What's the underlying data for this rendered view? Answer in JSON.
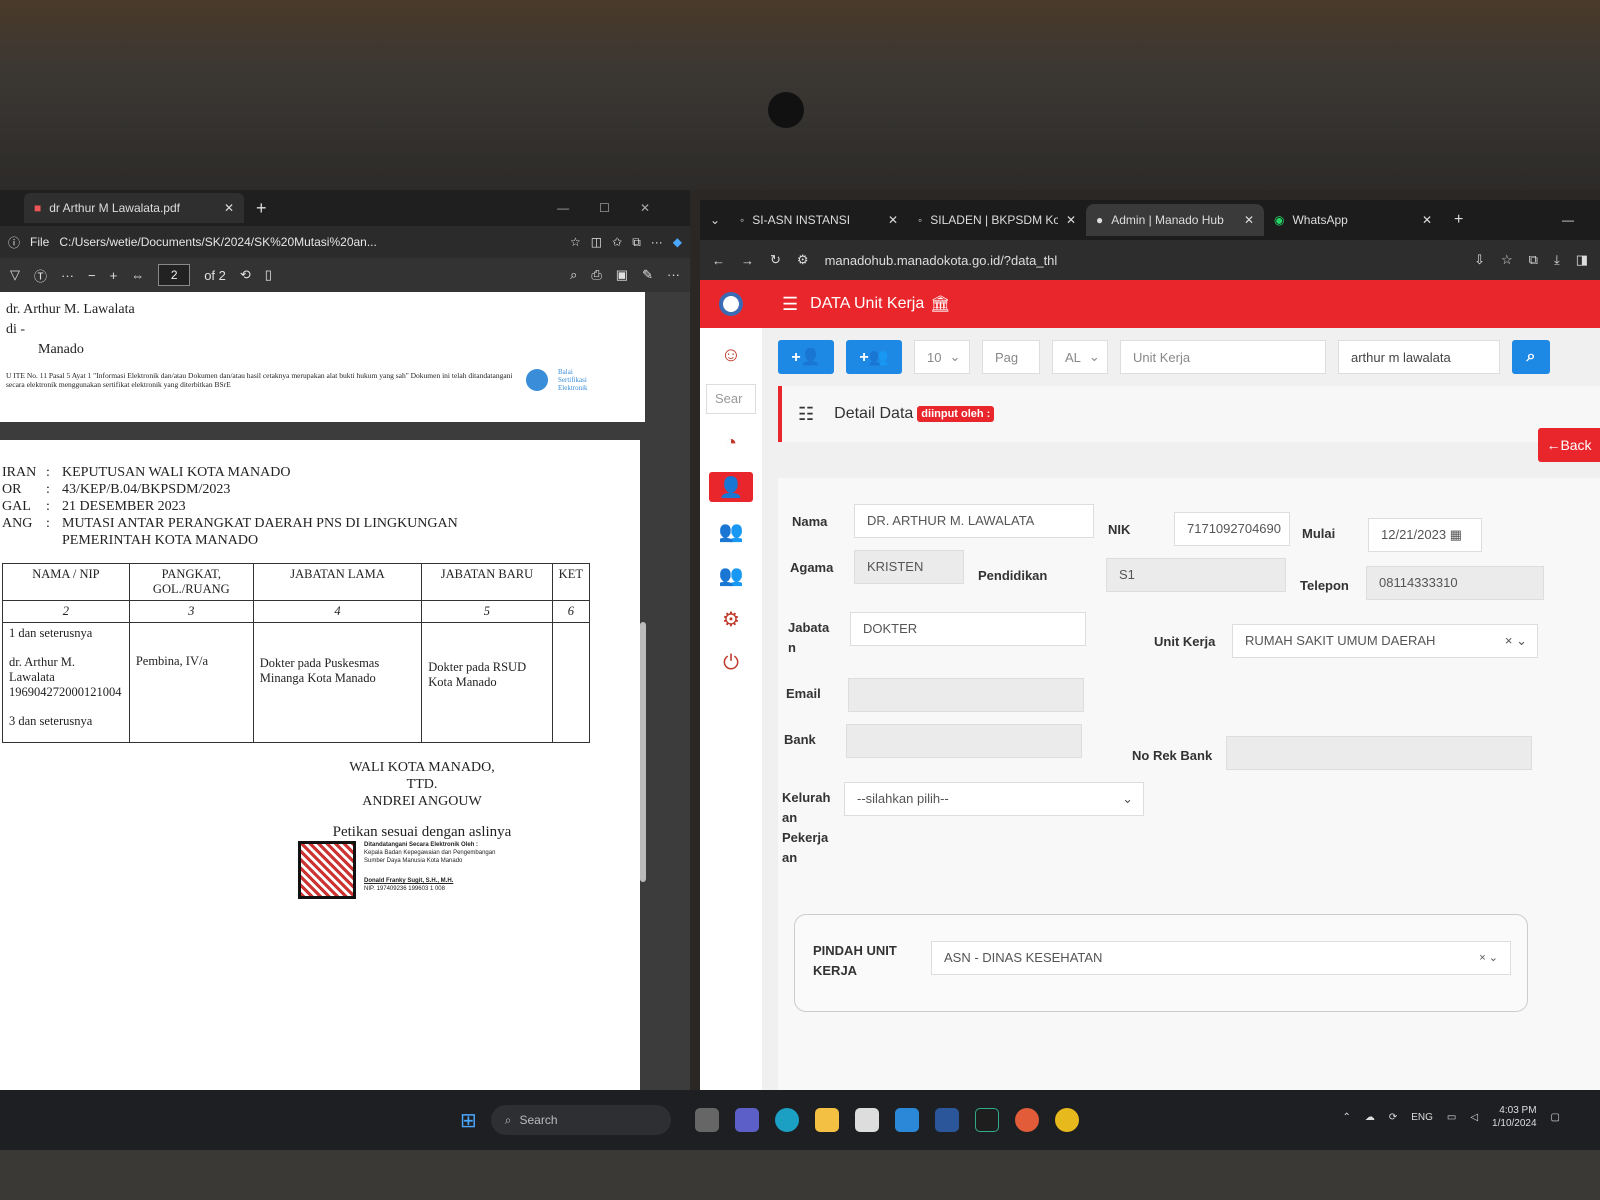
{
  "pdf": {
    "tab_title": "dr Arthur M Lawalata.pdf",
    "file_label": "File",
    "path": "C:/Users/wetie/Documents/SK/2024/SK%20Mutasi%20an...",
    "page_current": "2",
    "page_total": "of 2",
    "page1": {
      "name": "dr. Arthur M. Lawalata",
      "di": "di -",
      "city": "Manado",
      "note": "U ITE No. 11 Pasal 5 Ayat 1 \"Informasi Elektronik dan/atau Dokumen dan/atau hasil cetaknya merupakan alat bukti hukum yang sah\" Dokumen ini telah ditandatangani secara elektronik menggunakan sertifikat elektronik yang diterbitkan BSrE",
      "bsre_label": "Balai Sertifikasi Elektronik"
    },
    "page2": {
      "rows": [
        {
          "key": "IRAN",
          "sep": ":",
          "value": "KEPUTUSAN WALI KOTA MANADO"
        },
        {
          "key": "OR",
          "sep": ":",
          "value": "43/KEP/B.04/BKPSDM/2023"
        },
        {
          "key": "GAL",
          "sep": ":",
          "value": "21 DESEMBER 2023"
        },
        {
          "key": "ANG",
          "sep": ":",
          "value": "MUTASI ANTAR PERANGKAT DAERAH PNS DI LINGKUNGAN"
        },
        {
          "key": "",
          "sep": "",
          "value": "PEMERINTAH KOTA MANADO"
        }
      ],
      "table_headers": [
        "NAMA / NIP",
        "PANGKAT, GOL./RUANG",
        "JABATAN LAMA",
        "JABATAN BARU",
        "KET"
      ],
      "table_numbers": [
        "2",
        "3",
        "4",
        "5",
        "6"
      ],
      "row_first": "1 dan seterusnya",
      "row_name": "dr. Arthur M. Lawalata",
      "row_nip": "196904272000121004",
      "row_last": "3 dan seterusnya",
      "pangkat": "Pembina, IV/a",
      "jabatan_lama": "Dokter pada Puskesmas Minanga Kota Manado",
      "jabatan_baru": "Dokter pada RSUD Kota Manado",
      "sign_1": "WALI KOTA MANADO,",
      "sign_2": "TTD.",
      "sign_3": "ANDREI ANGOUW",
      "petikan": "Petikan sesuai dengan aslinya",
      "ditandatangani": "Ditandatangani Secara Elektronik Oleh :",
      "kepala": "Kepala Badan Kepegawaian dan Pengembangan Sumber Daya Manusia Kota Manado",
      "signer": "Donald Franky Sugit, S.H., M.H.",
      "signer_nip": "NIP. 197409236 199603 1 008"
    }
  },
  "browser": {
    "tabs": [
      {
        "title": "SI-ASN INSTANSI"
      },
      {
        "title": "SILADEN | BKPSDM Ko"
      },
      {
        "title": "Admin | Manado Hub"
      },
      {
        "title": "WhatsApp"
      }
    ],
    "url": "manadohub.manadokota.go.id/?data_thl"
  },
  "app": {
    "title": "DATA Unit Kerja",
    "sidebar_search": "Sear",
    "toolbar": {
      "per_page": "10",
      "page_placeholder": "Pag",
      "filter": "AL",
      "unit_placeholder": "Unit Kerja",
      "search_value": "arthur m lawalata"
    },
    "detail_title": "Detail Data",
    "badge": "diinput oleh :",
    "back_label": "Back",
    "form": {
      "nama_label": "Nama",
      "nama": "DR. ARTHUR M. LAWALATA",
      "nik_label": "NIK",
      "nik": "7171092704690",
      "mulai_label": "Mulai",
      "mulai": "12/21/2023",
      "agama_label": "Agama",
      "agama": "KRISTEN",
      "pendidikan_label": "Pendidikan",
      "pendidikan": "S1",
      "telepon_label": "Telepon",
      "telepon": "08114333310",
      "jabatan_label_1": "Jabata",
      "jabatan_label_2": "n",
      "jabatan": "DOKTER",
      "unit_label": "Unit Kerja",
      "unit": "RUMAH SAKIT UMUM DAERAH",
      "email_label": "Email",
      "email": "",
      "bank_label": "Bank",
      "bank": "",
      "norek_label": "No Rek Bank",
      "norek": "",
      "kel_label_1": "Kelurah",
      "kel_label_2": "an",
      "kel_label_3": "Pekerja",
      "kel_label_4": "an",
      "kel_placeholder": "--silahkan pilih--",
      "pindah_label_1": "PINDAH UNIT",
      "pindah_label_2": "KERJA",
      "pindah": "ASN - DINAS KESEHATAN"
    }
  },
  "taskbar": {
    "search": "Search",
    "lang": "ENG",
    "time": "4:03 PM",
    "date": "1/10/2024"
  },
  "colors": {
    "accent": "#e8262c",
    "primary": "#1e88e5"
  }
}
